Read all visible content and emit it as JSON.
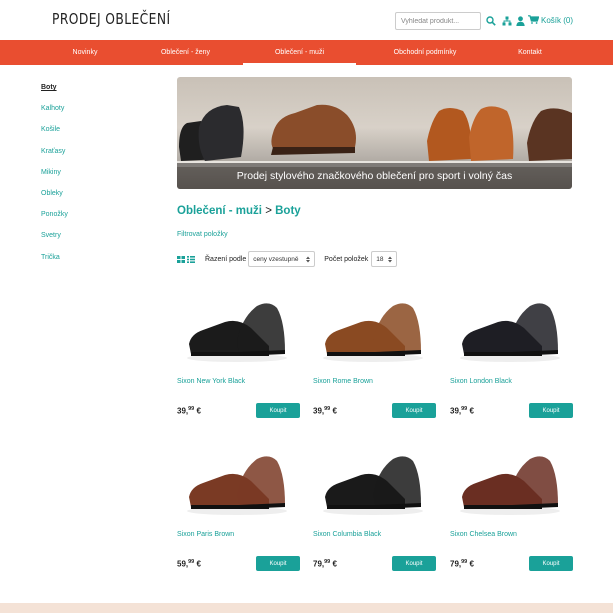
{
  "header": {
    "logo": "PRODEJ OBLEČENÍ",
    "search_placeholder": "Vyhledat produkt...",
    "cart_label": "Košík (0)",
    "icons": [
      "search-icon",
      "sitemap-icon",
      "user-icon",
      "cart-icon"
    ]
  },
  "nav": {
    "items": [
      {
        "label": "Novinky"
      },
      {
        "label": "Oblečení - ženy"
      },
      {
        "label": "Oblečení - muži"
      },
      {
        "label": "Obchodní podmínky"
      },
      {
        "label": "Kontakt"
      }
    ],
    "active": "Oblečení - muži"
  },
  "sidebar": {
    "items": [
      {
        "label": "Boty"
      },
      {
        "label": "Kalhoty"
      },
      {
        "label": "Košile"
      },
      {
        "label": "Kraťasy"
      },
      {
        "label": "Mikiny"
      },
      {
        "label": "Obleky"
      },
      {
        "label": "Ponožky"
      },
      {
        "label": "Svetry"
      },
      {
        "label": "Trička"
      }
    ],
    "active": "Boty"
  },
  "banner": {
    "caption": "Prodej stylového značkového oblečení pro sport i volný čas"
  },
  "breadcrumb": {
    "parent": "Oblečení - muži",
    "separator": ">",
    "current": "Boty"
  },
  "filter_label": "Filtrovat položky",
  "toolbar": {
    "sort_label": "Řazení podle",
    "sort_value": "ceny vzestupně",
    "count_label": "Počet položek",
    "count_value": "18"
  },
  "products": [
    {
      "name": "Sixon New York Black",
      "price_main": "39,",
      "price_cents": "99",
      "currency": "€",
      "button": "Koupit",
      "color": "#1b1b1b"
    },
    {
      "name": "Sixon Rome Brown",
      "price_main": "39,",
      "price_cents": "99",
      "currency": "€",
      "button": "Koupit",
      "color": "#8a4a22"
    },
    {
      "name": "Sixon London Black",
      "price_main": "39,",
      "price_cents": "99",
      "currency": "€",
      "button": "Koupit",
      "color": "#1e1e24"
    },
    {
      "name": "Sixon Paris Brown",
      "price_main": "59,",
      "price_cents": "99",
      "currency": "€",
      "button": "Koupit",
      "color": "#7a3a24"
    },
    {
      "name": "Sixon Columbia Black",
      "price_main": "79,",
      "price_cents": "99",
      "currency": "€",
      "button": "Koupit",
      "color": "#1a1a1a"
    },
    {
      "name": "Sixon Chelsea Brown",
      "price_main": "79,",
      "price_cents": "99",
      "currency": "€",
      "button": "Koupit",
      "color": "#6a2e22"
    }
  ],
  "colors": {
    "accent": "#1aa199",
    "nav": "#e94e30"
  }
}
